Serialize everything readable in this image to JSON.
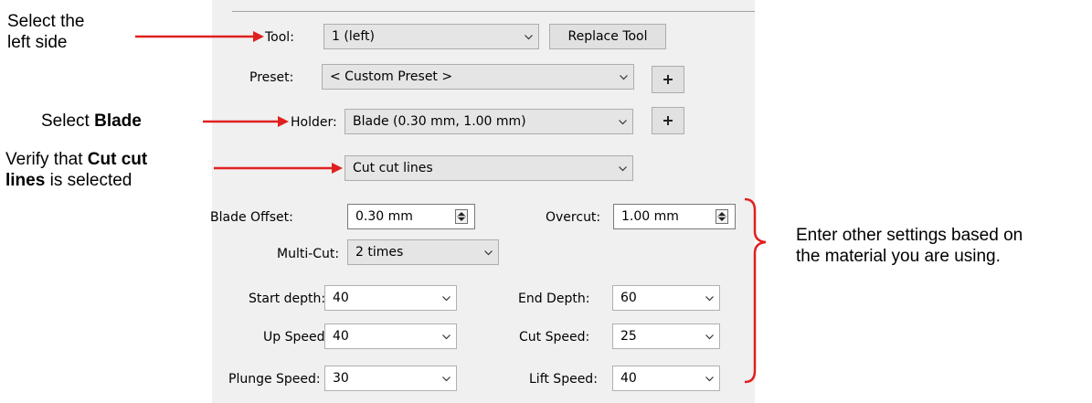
{
  "annotations": {
    "left_side": "Select the left side",
    "left_side_line1": "Select the",
    "left_side_line2": "left side",
    "blade_prefix": "Select ",
    "blade_bold": "Blade",
    "cutcut_line1_prefix": "Verify that ",
    "cutcut_line1_bold": "Cut cut",
    "cutcut_line2_bold": "lines",
    "cutcut_line2_suffix": " is selected",
    "other_line1": "Enter other settings based on",
    "other_line2": "the material you are using.",
    "arrow_color": "#e02020"
  },
  "tool": {
    "label": "Tool:",
    "value": "1 (left)",
    "replace_button": "Replace Tool"
  },
  "preset": {
    "label": "Preset:",
    "value": "< Custom Preset >"
  },
  "holder": {
    "label": "Holder:",
    "value": "Blade (0.30 mm, 1.00 mm)"
  },
  "cut_mode": {
    "value": "Cut cut lines"
  },
  "blade_offset": {
    "label": "Blade Offset:",
    "value": "0.30 mm"
  },
  "overcut": {
    "label": "Overcut:",
    "value": "1.00 mm"
  },
  "multi_cut": {
    "label": "Multi-Cut:",
    "value": "2 times"
  },
  "start_depth": {
    "label": "Start depth:",
    "value": "40"
  },
  "end_depth": {
    "label": "End Depth:",
    "value": "60"
  },
  "up_speed": {
    "label": "Up Speed:",
    "value": "40"
  },
  "cut_speed": {
    "label": "Cut Speed:",
    "value": "25"
  },
  "plunge_speed": {
    "label": "Plunge Speed:",
    "value": "30"
  },
  "lift_speed": {
    "label": "Lift Speed:",
    "value": "40"
  }
}
